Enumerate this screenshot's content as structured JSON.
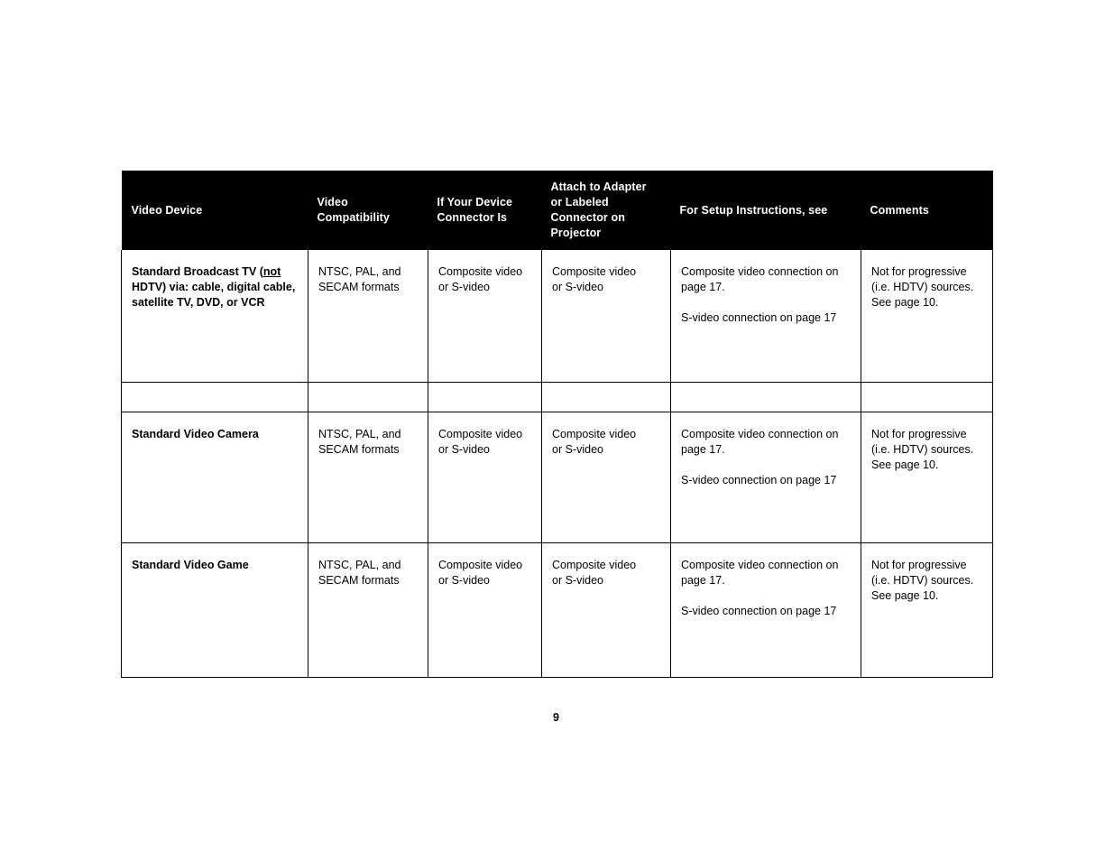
{
  "document": {
    "page_number": "9"
  },
  "table": {
    "headers": [
      "Video Device",
      "Video Compatibility",
      "If Your Device Connector Is",
      "Attach to Adapter or Labeled Connector on Projector",
      "For Setup Instructions, see",
      "Comments"
    ],
    "header_lines": {
      "col0": [
        "Video Device"
      ],
      "col1": [
        "Video",
        "Compatibility"
      ],
      "col2": [
        "If Your Device",
        "Connector Is"
      ],
      "col3": [
        "Attach to Adapter",
        "or Labeled",
        "Connector on",
        "Projector"
      ],
      "col4": [
        "For Setup Instructions, see"
      ],
      "col5": [
        "Comments"
      ]
    },
    "rows": [
      {
        "device_prefix": "Standard Broadcast TV (",
        "device_underlined": "not",
        "device_suffix": " HDTV) via: cable, digital cable, satellite TV, DVD, or VCR",
        "device_plain": "Standard Broadcast TV (not HDTV) via: cable, digital cable, satellite TV, DVD, or VCR",
        "compatibility": [
          "NTSC, PAL, and",
          "SECAM formats"
        ],
        "connector": [
          "Composite video",
          "or S-video"
        ],
        "attach": [
          "Composite video",
          "or S-video"
        ],
        "setup_block1": [
          "Composite video connection on",
          "page 17."
        ],
        "setup_block2": [
          "S-video connection on page 17"
        ],
        "comments": [
          "Not for progressive",
          "(i.e. HDTV) sources.",
          "See page 10."
        ]
      },
      {
        "device_plain": "Standard Video Camera",
        "compatibility": [
          "NTSC, PAL, and",
          "SECAM formats"
        ],
        "connector": [
          "Composite video",
          "or S-video"
        ],
        "attach": [
          "Composite video",
          "or S-video"
        ],
        "setup_block1": [
          "Composite video connection on",
          "page 17."
        ],
        "setup_block2": [
          "S-video connection on page 17"
        ],
        "comments": [
          "Not for progressive",
          "(i.e. HDTV) sources.",
          "See page 10."
        ]
      },
      {
        "device_plain": "Standard Video Game",
        "compatibility": [
          "NTSC, PAL, and",
          "SECAM formats"
        ],
        "connector": [
          "Composite video",
          "or S-video"
        ],
        "attach": [
          "Composite video",
          "or S-video"
        ],
        "setup_block1": [
          "Composite video connection on",
          "page 17."
        ],
        "setup_block2": [
          "S-video connection on page 17"
        ],
        "comments": [
          "Not for progressive",
          "(i.e. HDTV) sources.",
          "See page 10."
        ]
      }
    ]
  },
  "colors": {
    "header_background": "#000000",
    "header_text": "#ffffff",
    "body_text": "#000000",
    "border": "#000000",
    "page_background": "#ffffff"
  }
}
